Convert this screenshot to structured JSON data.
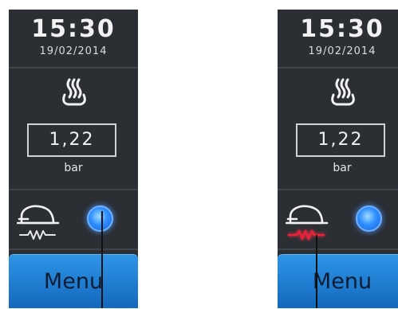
{
  "panels": [
    {
      "clock": {
        "time": "15:30",
        "date": "19/02/2014"
      },
      "pressure": {
        "value": "1,22",
        "unit": "bar"
      },
      "heater_color": "#e6e6e6",
      "menu_label": "Menu"
    },
    {
      "clock": {
        "time": "15:30",
        "date": "19/02/2014"
      },
      "pressure": {
        "value": "1,22",
        "unit": "bar"
      },
      "heater_color": "#e8223a",
      "menu_label": "Menu"
    }
  ],
  "icons": {
    "steam": "steam-icon",
    "boiler": "boiler-heater-icon",
    "status_light": "blue-status-light"
  },
  "colors": {
    "panel_bg": "#2b2e33",
    "menu_button": "#1f7fd6",
    "indicator": "#2f8fff"
  }
}
